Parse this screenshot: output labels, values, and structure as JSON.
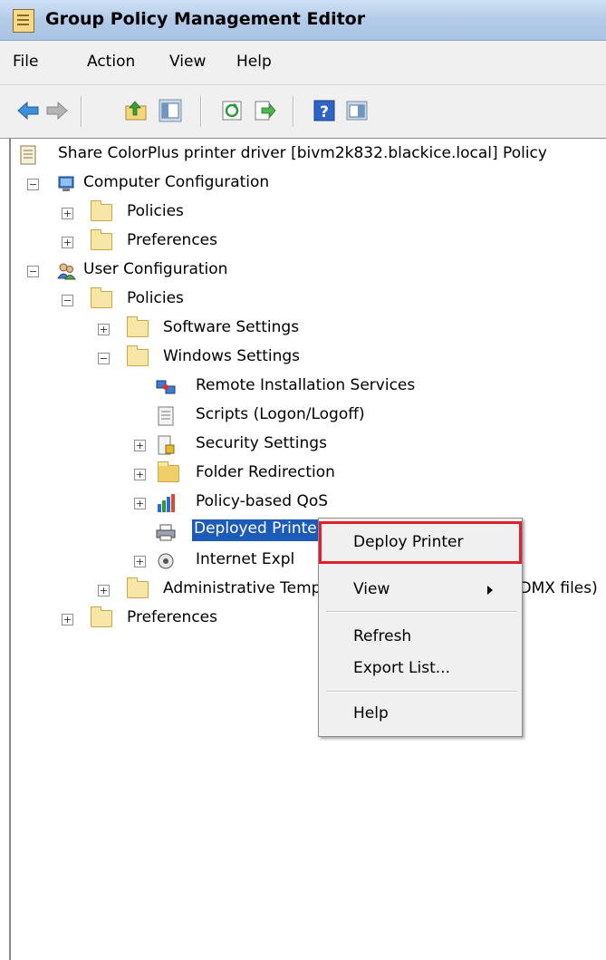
{
  "window": {
    "title": "Group Policy Management Editor"
  },
  "menu": [
    "File",
    "Action",
    "View",
    "Help"
  ],
  "toolbar": {
    "buttons": [
      "back-icon",
      "forward-icon",
      "up-folder-icon",
      "show-hide-console-tree-icon",
      "refresh-icon",
      "export-list-icon",
      "help-icon",
      "show-action-pane-icon"
    ]
  },
  "tree": {
    "root": "Share ColorPlus printer driver [bivm2k832.blackice.local] Policy",
    "computer_configuration": "Computer Configuration",
    "cc_policies": "Policies",
    "cc_preferences": "Preferences",
    "user_configuration": "User Configuration",
    "uc_policies": "Policies",
    "software_settings": "Software Settings",
    "windows_settings": "Windows Settings",
    "remote_installation": "Remote Installation Services",
    "scripts": "Scripts (Logon/Logoff)",
    "security_settings": "Security Settings",
    "folder_redirection": "Folder Redirection",
    "policy_qos": "Policy-based QoS",
    "deployed_printers": "Deployed Printers",
    "internet_explorer": "Internet Explorer Maintenance",
    "admin_templates": "Administrative Templates: Policy definitions (ADMX files)",
    "uc_preferences": "Preferences"
  },
  "context_menu": {
    "deploy_printer": "Deploy Printer",
    "view": "View",
    "refresh": "Refresh",
    "export_list": "Export List...",
    "help": "Help"
  },
  "colors": {
    "selection": "#1c5bb8",
    "highlight_box": "#e0202e"
  }
}
